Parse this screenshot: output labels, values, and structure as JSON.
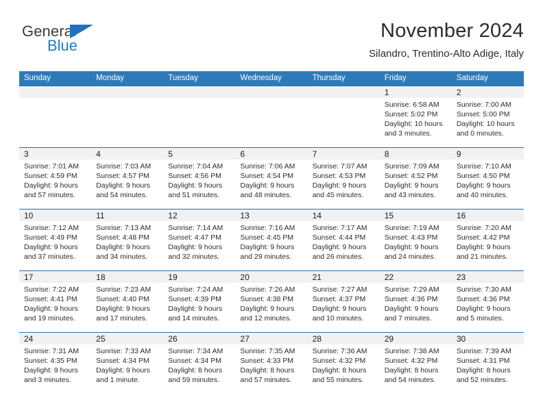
{
  "brand": {
    "name_top": "General",
    "name_bottom": "Blue"
  },
  "header": {
    "title": "November 2024",
    "subtitle": "Silandro, Trentino-Alto Adige, Italy"
  },
  "colors": {
    "header_blue": "#2e7ab8",
    "row_rule": "#2e6da4",
    "daynum_strip": "#f1f1f1",
    "logo_blue": "#1f7ac4",
    "text": "#2b2b2b"
  },
  "weekdays": [
    "Sunday",
    "Monday",
    "Tuesday",
    "Wednesday",
    "Thursday",
    "Friday",
    "Saturday"
  ],
  "labels": {
    "sunrise": "Sunrise:",
    "sunset": "Sunset:",
    "daylight": "Daylight:"
  },
  "weeks": [
    [
      {
        "day": ""
      },
      {
        "day": ""
      },
      {
        "day": ""
      },
      {
        "day": ""
      },
      {
        "day": ""
      },
      {
        "day": "1",
        "sunrise": "Sunrise: 6:58 AM",
        "sunset": "Sunset: 5:02 PM",
        "daylight_1": "Daylight: 10 hours",
        "daylight_2": "and 3 minutes."
      },
      {
        "day": "2",
        "sunrise": "Sunrise: 7:00 AM",
        "sunset": "Sunset: 5:00 PM",
        "daylight_1": "Daylight: 10 hours",
        "daylight_2": "and 0 minutes."
      }
    ],
    [
      {
        "day": "3",
        "sunrise": "Sunrise: 7:01 AM",
        "sunset": "Sunset: 4:59 PM",
        "daylight_1": "Daylight: 9 hours",
        "daylight_2": "and 57 minutes."
      },
      {
        "day": "4",
        "sunrise": "Sunrise: 7:03 AM",
        "sunset": "Sunset: 4:57 PM",
        "daylight_1": "Daylight: 9 hours",
        "daylight_2": "and 54 minutes."
      },
      {
        "day": "5",
        "sunrise": "Sunrise: 7:04 AM",
        "sunset": "Sunset: 4:56 PM",
        "daylight_1": "Daylight: 9 hours",
        "daylight_2": "and 51 minutes."
      },
      {
        "day": "6",
        "sunrise": "Sunrise: 7:06 AM",
        "sunset": "Sunset: 4:54 PM",
        "daylight_1": "Daylight: 9 hours",
        "daylight_2": "and 48 minutes."
      },
      {
        "day": "7",
        "sunrise": "Sunrise: 7:07 AM",
        "sunset": "Sunset: 4:53 PM",
        "daylight_1": "Daylight: 9 hours",
        "daylight_2": "and 45 minutes."
      },
      {
        "day": "8",
        "sunrise": "Sunrise: 7:09 AM",
        "sunset": "Sunset: 4:52 PM",
        "daylight_1": "Daylight: 9 hours",
        "daylight_2": "and 43 minutes."
      },
      {
        "day": "9",
        "sunrise": "Sunrise: 7:10 AM",
        "sunset": "Sunset: 4:50 PM",
        "daylight_1": "Daylight: 9 hours",
        "daylight_2": "and 40 minutes."
      }
    ],
    [
      {
        "day": "10",
        "sunrise": "Sunrise: 7:12 AM",
        "sunset": "Sunset: 4:49 PM",
        "daylight_1": "Daylight: 9 hours",
        "daylight_2": "and 37 minutes."
      },
      {
        "day": "11",
        "sunrise": "Sunrise: 7:13 AM",
        "sunset": "Sunset: 4:48 PM",
        "daylight_1": "Daylight: 9 hours",
        "daylight_2": "and 34 minutes."
      },
      {
        "day": "12",
        "sunrise": "Sunrise: 7:14 AM",
        "sunset": "Sunset: 4:47 PM",
        "daylight_1": "Daylight: 9 hours",
        "daylight_2": "and 32 minutes."
      },
      {
        "day": "13",
        "sunrise": "Sunrise: 7:16 AM",
        "sunset": "Sunset: 4:45 PM",
        "daylight_1": "Daylight: 9 hours",
        "daylight_2": "and 29 minutes."
      },
      {
        "day": "14",
        "sunrise": "Sunrise: 7:17 AM",
        "sunset": "Sunset: 4:44 PM",
        "daylight_1": "Daylight: 9 hours",
        "daylight_2": "and 26 minutes."
      },
      {
        "day": "15",
        "sunrise": "Sunrise: 7:19 AM",
        "sunset": "Sunset: 4:43 PM",
        "daylight_1": "Daylight: 9 hours",
        "daylight_2": "and 24 minutes."
      },
      {
        "day": "16",
        "sunrise": "Sunrise: 7:20 AM",
        "sunset": "Sunset: 4:42 PM",
        "daylight_1": "Daylight: 9 hours",
        "daylight_2": "and 21 minutes."
      }
    ],
    [
      {
        "day": "17",
        "sunrise": "Sunrise: 7:22 AM",
        "sunset": "Sunset: 4:41 PM",
        "daylight_1": "Daylight: 9 hours",
        "daylight_2": "and 19 minutes."
      },
      {
        "day": "18",
        "sunrise": "Sunrise: 7:23 AM",
        "sunset": "Sunset: 4:40 PM",
        "daylight_1": "Daylight: 9 hours",
        "daylight_2": "and 17 minutes."
      },
      {
        "day": "19",
        "sunrise": "Sunrise: 7:24 AM",
        "sunset": "Sunset: 4:39 PM",
        "daylight_1": "Daylight: 9 hours",
        "daylight_2": "and 14 minutes."
      },
      {
        "day": "20",
        "sunrise": "Sunrise: 7:26 AM",
        "sunset": "Sunset: 4:38 PM",
        "daylight_1": "Daylight: 9 hours",
        "daylight_2": "and 12 minutes."
      },
      {
        "day": "21",
        "sunrise": "Sunrise: 7:27 AM",
        "sunset": "Sunset: 4:37 PM",
        "daylight_1": "Daylight: 9 hours",
        "daylight_2": "and 10 minutes."
      },
      {
        "day": "22",
        "sunrise": "Sunrise: 7:29 AM",
        "sunset": "Sunset: 4:36 PM",
        "daylight_1": "Daylight: 9 hours",
        "daylight_2": "and 7 minutes."
      },
      {
        "day": "23",
        "sunrise": "Sunrise: 7:30 AM",
        "sunset": "Sunset: 4:36 PM",
        "daylight_1": "Daylight: 9 hours",
        "daylight_2": "and 5 minutes."
      }
    ],
    [
      {
        "day": "24",
        "sunrise": "Sunrise: 7:31 AM",
        "sunset": "Sunset: 4:35 PM",
        "daylight_1": "Daylight: 9 hours",
        "daylight_2": "and 3 minutes."
      },
      {
        "day": "25",
        "sunrise": "Sunrise: 7:33 AM",
        "sunset": "Sunset: 4:34 PM",
        "daylight_1": "Daylight: 9 hours",
        "daylight_2": "and 1 minute."
      },
      {
        "day": "26",
        "sunrise": "Sunrise: 7:34 AM",
        "sunset": "Sunset: 4:34 PM",
        "daylight_1": "Daylight: 8 hours",
        "daylight_2": "and 59 minutes."
      },
      {
        "day": "27",
        "sunrise": "Sunrise: 7:35 AM",
        "sunset": "Sunset: 4:33 PM",
        "daylight_1": "Daylight: 8 hours",
        "daylight_2": "and 57 minutes."
      },
      {
        "day": "28",
        "sunrise": "Sunrise: 7:36 AM",
        "sunset": "Sunset: 4:32 PM",
        "daylight_1": "Daylight: 8 hours",
        "daylight_2": "and 55 minutes."
      },
      {
        "day": "29",
        "sunrise": "Sunrise: 7:38 AM",
        "sunset": "Sunset: 4:32 PM",
        "daylight_1": "Daylight: 8 hours",
        "daylight_2": "and 54 minutes."
      },
      {
        "day": "30",
        "sunrise": "Sunrise: 7:39 AM",
        "sunset": "Sunset: 4:31 PM",
        "daylight_1": "Daylight: 8 hours",
        "daylight_2": "and 52 minutes."
      }
    ]
  ]
}
